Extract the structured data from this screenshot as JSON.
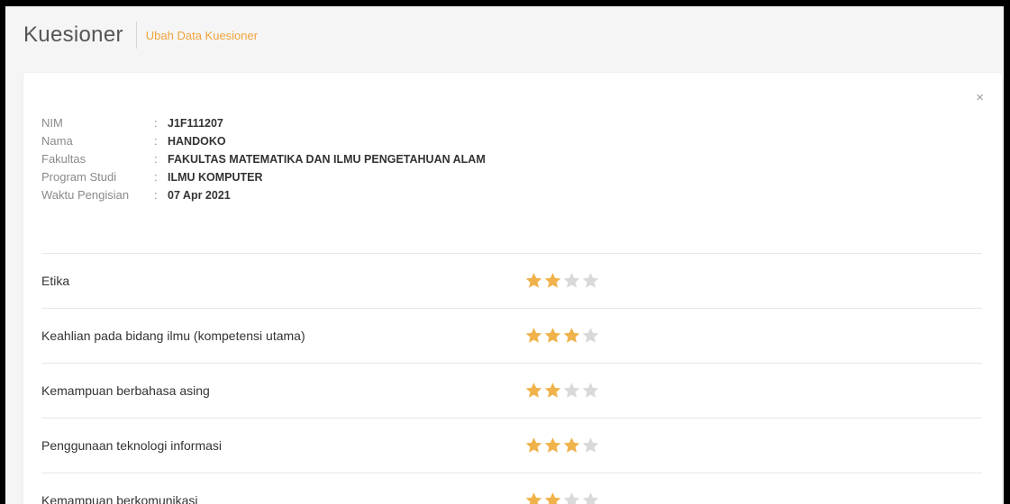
{
  "header": {
    "title": "Kuesioner",
    "edit_link": "Ubah Data Kuesioner"
  },
  "card": {
    "close_symbol": "×"
  },
  "info": [
    {
      "label": "NIM",
      "sep": ":",
      "value": "J1F111207"
    },
    {
      "label": "Nama",
      "sep": ":",
      "value": "HANDOKO"
    },
    {
      "label": "Fakultas",
      "sep": ":",
      "value": "FAKULTAS MATEMATIKA DAN ILMU PENGETAHUAN ALAM"
    },
    {
      "label": "Program Studi",
      "sep": ":",
      "value": "ILMU KOMPUTER"
    },
    {
      "label": "Waktu Pengisian",
      "sep": ":",
      "value": "07 Apr 2021"
    }
  ],
  "ratings": [
    {
      "label": "Etika",
      "rating": 2,
      "max": 4
    },
    {
      "label": "Keahlian pada bidang ilmu (kompetensi utama)",
      "rating": 3,
      "max": 4
    },
    {
      "label": "Kemampuan berbahasa asing",
      "rating": 2,
      "max": 4
    },
    {
      "label": "Penggunaan teknologi informasi",
      "rating": 3,
      "max": 4
    },
    {
      "label": "Kemampuan berkomunikasi",
      "rating": 2,
      "max": 4
    }
  ],
  "colors": {
    "accent": "#f0a43a",
    "star_filled": "#f0b24a",
    "star_empty": "#d9d9d9"
  }
}
